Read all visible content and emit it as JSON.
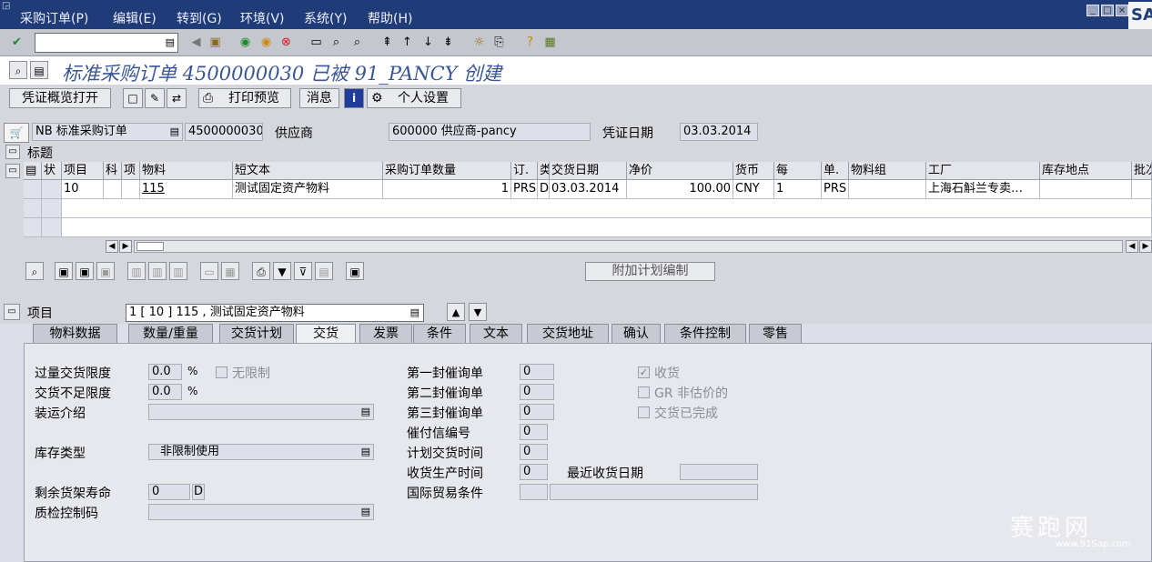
{
  "menu": [
    "采购订单(P)",
    "编辑(E)",
    "转到(G)",
    "环境(V)",
    "系统(Y)",
    "帮助(H)"
  ],
  "window_buttons": [
    "_",
    "□",
    "×"
  ],
  "sap_logo": "SAP",
  "title": "标准采购订单 4500000030 已被 91_PANCY 创建",
  "app_toolbar": {
    "overview_button": "凭证概览打开",
    "print_preview": "打印预览",
    "messages": "消息",
    "personal_settings": "个人设置"
  },
  "header": {
    "doc_type": "NB 标准采购订单",
    "po_number": "4500000030",
    "vendor_label": "供应商",
    "vendor_value": "600000 供应商-pancy",
    "doc_date_label": "凭证日期",
    "doc_date_value": "03.03.2014",
    "header_section": "标题"
  },
  "grid": {
    "columns": [
      "状",
      "项目",
      "科",
      "项",
      "物料",
      "短文本",
      "采购订单数量",
      "订.",
      "类",
      "交货日期",
      "净价",
      "货币",
      "每",
      "单.",
      "物料组",
      "工厂",
      "库存地点",
      "批次"
    ],
    "rows": [
      {
        "item": "10",
        "material": "115",
        "short_text": "测试固定资产物料",
        "qty": "1",
        "unit": "PRS",
        "date_cat": "D",
        "delivery_date": "03.03.2014",
        "net_price": "100.00",
        "currency": "CNY",
        "per": "1",
        "order_unit": "PRS",
        "plant": "上海石斛兰专卖…"
      }
    ],
    "add_schedule_button": "附加计划编制"
  },
  "item": {
    "label": "项目",
    "selected": "1 [ 10 ] 115 , 测试固定资产物料"
  },
  "tabs": [
    "物料数据",
    "数量/重量",
    "交货计划",
    "交货",
    "发票",
    "条件",
    "文本",
    "交货地址",
    "确认",
    "条件控制",
    "零售"
  ],
  "active_tab": "交货",
  "delivery": {
    "overdelivery_label": "过量交货限度",
    "overdelivery_value": "0.0",
    "underdelivery_label": "交货不足限度",
    "underdelivery_value": "0.0",
    "percent": "%",
    "unlimited_label": "无限制",
    "shipping_instr_label": "装运介绍",
    "stock_type_label": "库存类型",
    "stock_type_value": "非限制使用",
    "shelf_life_label": "剩余货架寿命",
    "shelf_life_value": "0",
    "shelf_life_unit": "D",
    "qm_control_label": "质检控制码",
    "reminder1_label": "第一封催询单",
    "reminder1_value": "0",
    "reminder2_label": "第二封催询单",
    "reminder2_value": "0",
    "reminder3_label": "第三封催询单",
    "reminder3_value": "0",
    "urging_no_label": "催付信编号",
    "urging_no_value": "0",
    "planned_time_label": "计划交货时间",
    "planned_time_value": "0",
    "gr_time_label": "收货生产时间",
    "gr_time_value": "0",
    "last_gr_date_label": "最近收货日期",
    "incoterms_label": "国际贸易条件",
    "goods_receipt_label": "收货",
    "gr_non_valuated_label": "GR 非估价的",
    "delivery_completed_label": "交货已完成"
  },
  "watermark": {
    "text": "赛跑网",
    "url": "www.91Sap.com"
  }
}
